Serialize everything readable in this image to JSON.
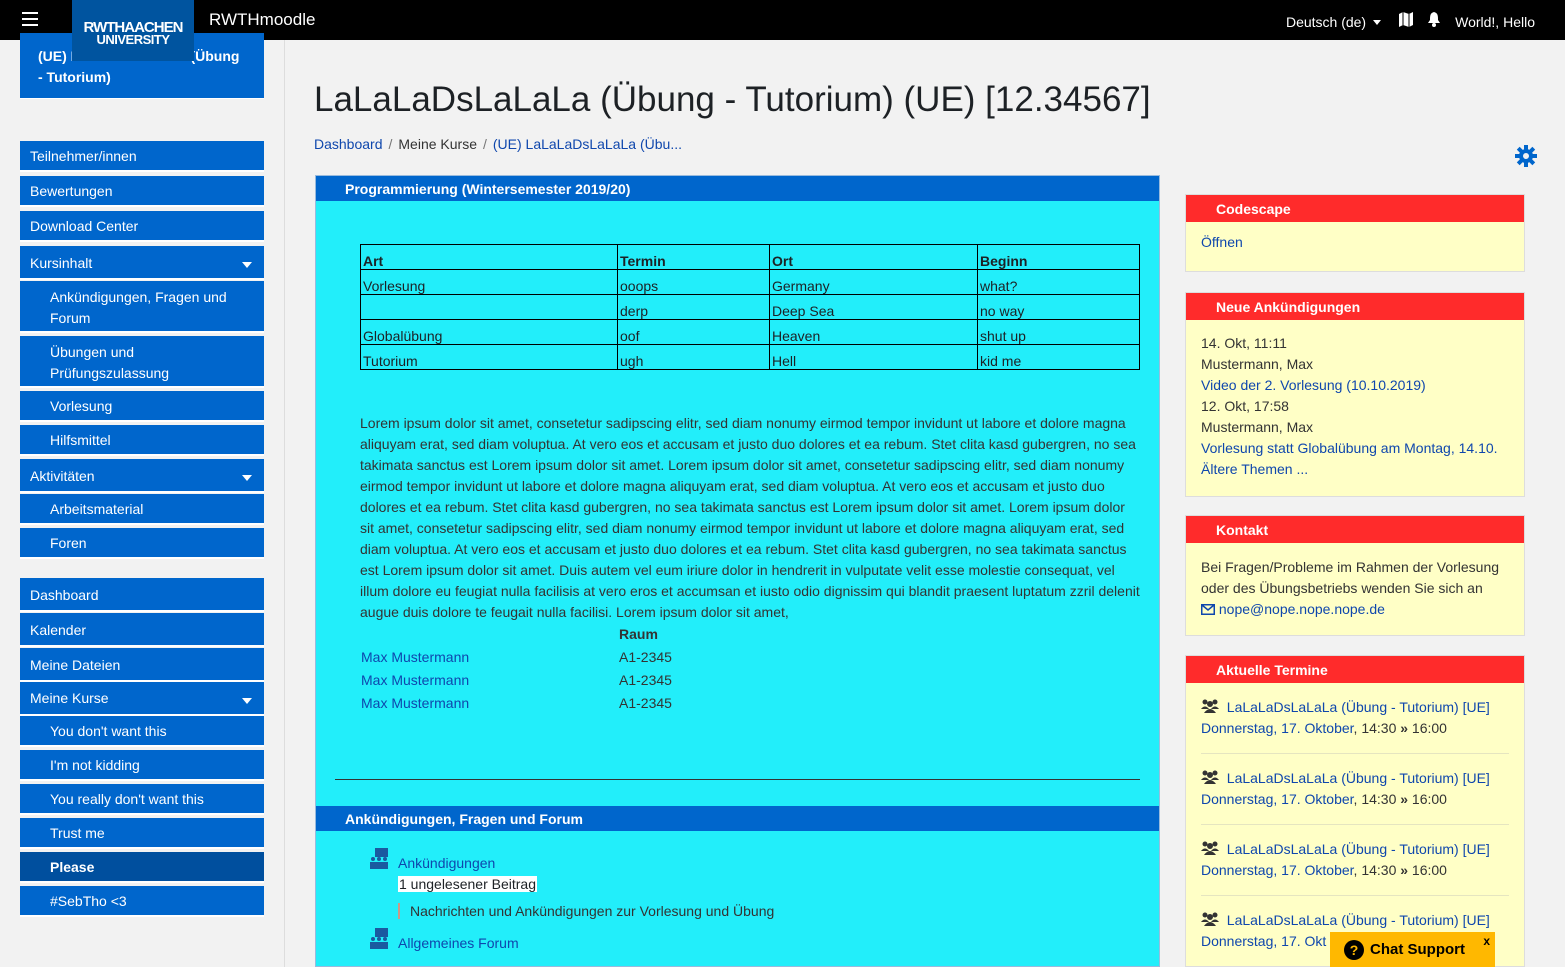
{
  "navbar": {
    "logo_line1": "RWTHAACHEN",
    "logo_line2": "UNIVERSITY",
    "site_name": "RWTHmoodle",
    "language": "Deutsch (de)",
    "user_name": "World!, Hello"
  },
  "drawer": {
    "course_title": "(UE) LaLaLaDsLaLaLa (Übung - Tutorium)",
    "items": [
      {
        "label": "Teilnehmer/innen"
      },
      {
        "label": "Bewertungen"
      },
      {
        "label": "Download Center"
      },
      {
        "label": "Kursinhalt"
      },
      {
        "label": "Ankündigungen, Fragen und Forum"
      },
      {
        "label": "Übungen und Prüfungszulassung"
      },
      {
        "label": "Vorlesung"
      },
      {
        "label": "Hilfsmittel"
      },
      {
        "label": "Aktivitäten"
      },
      {
        "label": "Arbeitsmaterial"
      },
      {
        "label": "Foren"
      }
    ],
    "items2": [
      {
        "label": "Dashboard"
      },
      {
        "label": "Kalender"
      },
      {
        "label": "Meine Dateien"
      },
      {
        "label": "Meine Kurse"
      },
      {
        "label": "You don't want this"
      },
      {
        "label": "I'm not kidding"
      },
      {
        "label": "You really don't want this"
      },
      {
        "label": "Trust me"
      },
      {
        "label": "Please"
      },
      {
        "label": "#SebTho <3"
      }
    ]
  },
  "page": {
    "title": "LaLaLaDsLaLaLa (Übung - Tutorium) (UE) [12.34567]",
    "breadcrumb": [
      "Dashboard",
      "Meine Kurse",
      "(UE) LaLaLaDsLaLaLa (Übu..."
    ]
  },
  "main": {
    "section1_title": "Programmierung (Wintersemester 2019/20)",
    "table_headers": [
      "Art",
      "Termin",
      "Ort",
      "Beginn"
    ],
    "table_rows": [
      [
        "Vorlesung",
        "ooops",
        "Germany",
        "what?"
      ],
      [
        "",
        "derp",
        "Deep Sea",
        "no way"
      ],
      [
        "Globalübung",
        "oof",
        "Heaven",
        "shut up"
      ],
      [
        "Tutorium",
        "ugh",
        "Hell",
        "kid me"
      ]
    ],
    "lorem": "Lorem ipsum dolor sit amet, consetetur sadipscing elitr, sed diam nonumy eirmod tempor invidunt ut labore et dolore magna aliquyam erat, sed diam voluptua. At vero eos et accusam et justo duo dolores et ea rebum. Stet clita kasd gubergren, no sea takimata sanctus est Lorem ipsum dolor sit amet. Lorem ipsum dolor sit amet, consetetur sadipscing elitr, sed diam nonumy eirmod tempor invidunt ut labore et dolore magna aliquyam erat, sed diam voluptua. At vero eos et accusam et justo duo dolores et ea rebum. Stet clita kasd gubergren, no sea takimata sanctus est Lorem ipsum dolor sit amet. Lorem ipsum dolor sit amet, consetetur sadipscing elitr, sed diam nonumy eirmod tempor invidunt ut labore et dolore magna aliquyam erat, sed diam voluptua. At vero eos et accusam et justo duo dolores et ea rebum. Stet clita kasd gubergren, no sea takimata sanctus est Lorem ipsum dolor sit amet. Duis autem vel eum iriure dolor in hendrerit in vulputate velit esse molestie consequat, vel illum dolore eu feugiat nulla facilisis at vero eros et accumsan et iusto odio dignissim qui blandit praesent luptatum zzril delenit augue duis dolore te feugait nulla facilisi. Lorem ipsum dolor sit amet,",
    "room_header": "Raum",
    "rooms": [
      {
        "name": "Max Mustermann",
        "room": "A1-2345"
      },
      {
        "name": "Max Mustermann",
        "room": "A1-2345"
      },
      {
        "name": "Max Mustermann",
        "room": "A1-2345"
      }
    ],
    "section2_title": "Ankündigungen, Fragen und Forum",
    "forum1": "Ankündigungen",
    "unread": "1 ungelesener Beitrag",
    "forum1_desc": "Nachrichten und Ankündigungen zur Vorlesung und Übung",
    "forum2": "Allgemeines Forum"
  },
  "blocks": {
    "codescape": {
      "title": "Codescape",
      "link": "Öffnen"
    },
    "news": {
      "title": "Neue Ankündigungen",
      "items": [
        {
          "date": "14. Okt, 11:11",
          "author": "Mustermann, Max",
          "subject": "Video der 2. Vorlesung (10.10.2019)"
        },
        {
          "date": "12. Okt, 17:58",
          "author": "Mustermann, Max",
          "subject": "Vorlesung statt Globalübung am Montag, 14.10."
        }
      ],
      "older": "Ältere Themen ..."
    },
    "contact": {
      "title": "Kontakt",
      "text": "Bei Fragen/Probleme im Rahmen der Vorlesung oder des Übungsbetriebs wenden Sie sich an",
      "email": "nope@nope.nope.nope.de"
    },
    "events": {
      "title": "Aktuelle Termine",
      "items": [
        {
          "name": "LaLaLaDsLaLaLa (Übung - Tutorium) [UE]",
          "date": "Donnerstag, 17. Oktober",
          "time": ", 14:30 ",
          "end": " 16:00"
        },
        {
          "name": "LaLaLaDsLaLaLa (Übung - Tutorium) [UE]",
          "date": "Donnerstag, 17. Oktober",
          "time": ", 14:30 ",
          "end": " 16:00"
        },
        {
          "name": "LaLaLaDsLaLaLa (Übung - Tutorium) [UE]",
          "date": "Donnerstag, 17. Oktober",
          "time": ", 14:30 ",
          "end": " 16:00"
        },
        {
          "name": "LaLaLaDsLaLaLa (Übung - Tutorium) [UE]",
          "date": "Donnerstag, 17. Okt"
        }
      ]
    }
  },
  "chat": {
    "label": "Chat Support",
    "close": "x",
    "icon": "?"
  },
  "colors": {
    "navbar": "#000000",
    "drawer_item": "#0066cc",
    "main_bg": "#22eefa",
    "block_head": "#ff2b2b",
    "block_bg": "#ffffc6",
    "chat": "#ffb800"
  }
}
